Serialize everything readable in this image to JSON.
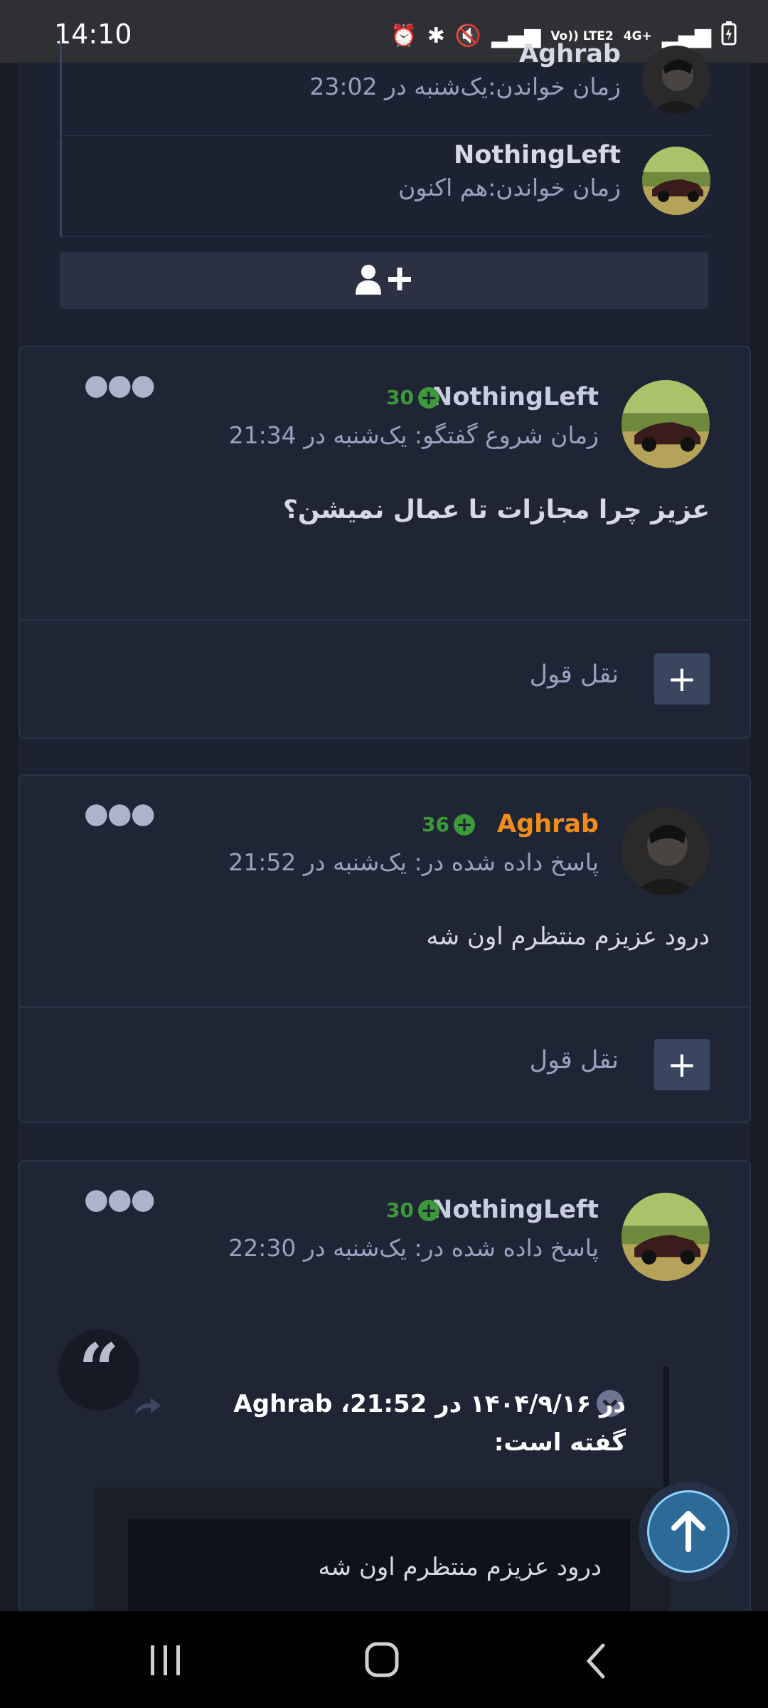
{
  "status_bar": {
    "time": "14:10",
    "icons": [
      "alarm-icon",
      "bluetooth-icon",
      "mute-icon",
      "signal-icon",
      "volte-icon",
      "4g-icon",
      "signal-icon",
      "battery-icon"
    ],
    "volte_label": "Vo)) LTE2",
    "data_label": "4G+"
  },
  "readers": [
    {
      "name": "Aghrab",
      "time_label": "زمان خواندن:یک‌شنبه در 23:02"
    },
    {
      "name": "NothingLeft",
      "time_label": "زمان خواندن:هم اکنون"
    }
  ],
  "add_reader_icon": "add-user-icon",
  "posts": [
    {
      "username": "NothingLeft",
      "reputation": "30",
      "meta": "زمان شروع گفتگو: یک‌شنبه در 21:34",
      "body": "عزیز چرا مجازات تا عمال نمیشن؟",
      "quote_label": "نقل قول",
      "name_color": "#d5d8e6"
    },
    {
      "username": "Aghrab",
      "reputation": "36",
      "meta": "پاسخ داده شده در: یک‌شنبه در 21:52",
      "body": "درود عزیزم منتظرم اون شه",
      "quote_label": "نقل قول",
      "name_color": "#f08c1a"
    },
    {
      "username": "NothingLeft",
      "reputation": "30",
      "meta": "پاسخ داده شده در: یک‌شنبه در 22:30",
      "quote": {
        "header": "در ۱۴۰۴/۹/۱۶ در 21:52، Aghrab گفته است:",
        "text": "درود عزیزم منتظرم اون شه"
      }
    }
  ],
  "colors": {
    "background": "#161b26",
    "card": "#1f2535",
    "reputation_green": "#3d9a3a",
    "accent_orange": "#f08c1a",
    "muted_text": "#9aa0bf"
  }
}
